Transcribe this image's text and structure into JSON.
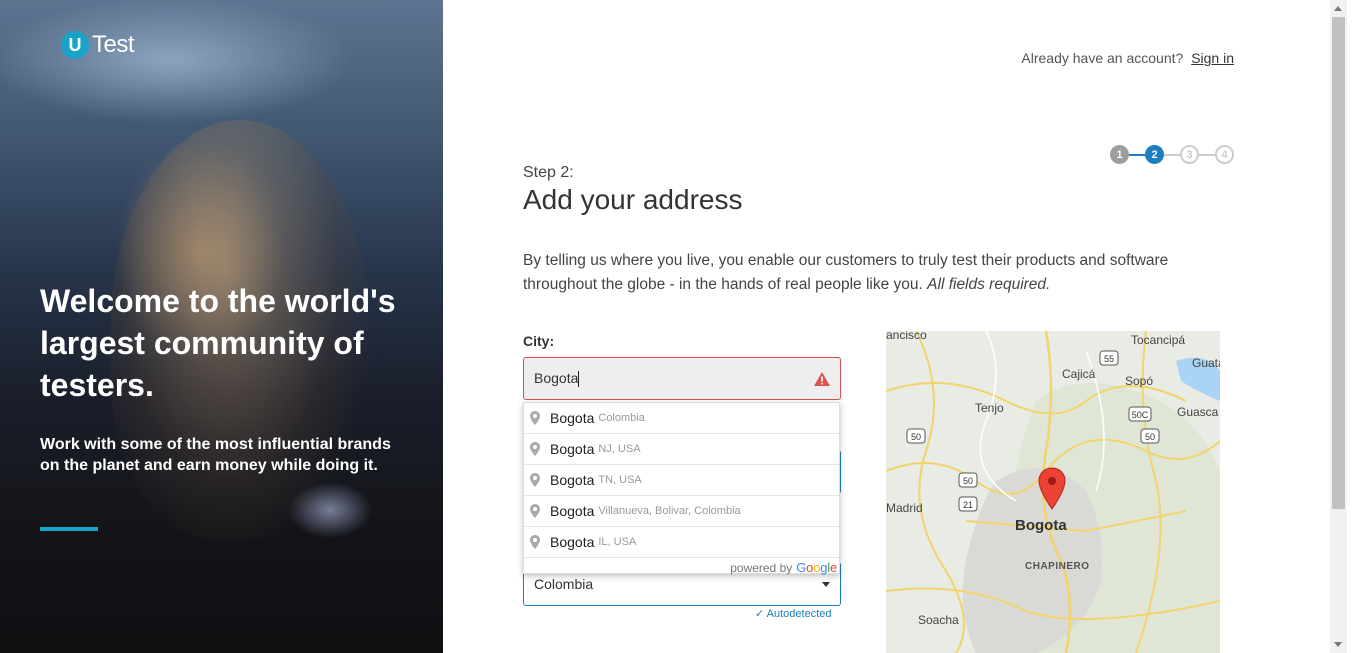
{
  "brand": {
    "logo_letter": "U",
    "logo_text": "Test",
    "accent": "#1aa3c9"
  },
  "hero": {
    "title": "Welcome to the world's largest community of testers.",
    "subtitle": "Work with some of the most influential brands on the planet and earn money while doing it."
  },
  "header": {
    "account_prompt": "Already have an account?",
    "sign_in": "Sign in"
  },
  "steps": {
    "items": [
      "1",
      "2",
      "3",
      "4"
    ],
    "current": 2
  },
  "form": {
    "step_label": "Step 2:",
    "title": "Add your address",
    "intro": "By telling us where you live, you enable our customers to truly test their products and software throughout the globe - in the hands of real people like you.",
    "intro_emphasis": "All fields required.",
    "city_label": "City:",
    "city_value": "Bogota",
    "country_value": "Colombia",
    "autodetected": "Autodetected"
  },
  "autocomplete": {
    "items": [
      {
        "main": "Bogota",
        "secondary": "Colombia"
      },
      {
        "main": "Bogota",
        "secondary": "NJ, USA"
      },
      {
        "main": "Bogota",
        "secondary": "TN, USA"
      },
      {
        "main": "Bogota",
        "secondary": "Villanueva, Bolivar, Colombia"
      },
      {
        "main": "Bogota",
        "secondary": "IL, USA"
      }
    ],
    "footer_prefix": "powered by",
    "footer_brand": "Google"
  },
  "map": {
    "labels": {
      "francisco": "ancisco",
      "tocancipa": "Tocancipá",
      "guata": "Guata",
      "cajica": "Cajicá",
      "sopo": "Sopó",
      "tenjo": "Tenjo",
      "guasca": "Guasca",
      "madrid": "Madrid",
      "bogota": "Bogota",
      "chapinero": "CHAPINERO",
      "soacha": "Soacha"
    },
    "shields": {
      "r55": "55",
      "r50c": "50C",
      "r50a": "50",
      "r50b": "50",
      "r50c2": "50",
      "r21": "21"
    },
    "marker_color": "#ea4335"
  }
}
